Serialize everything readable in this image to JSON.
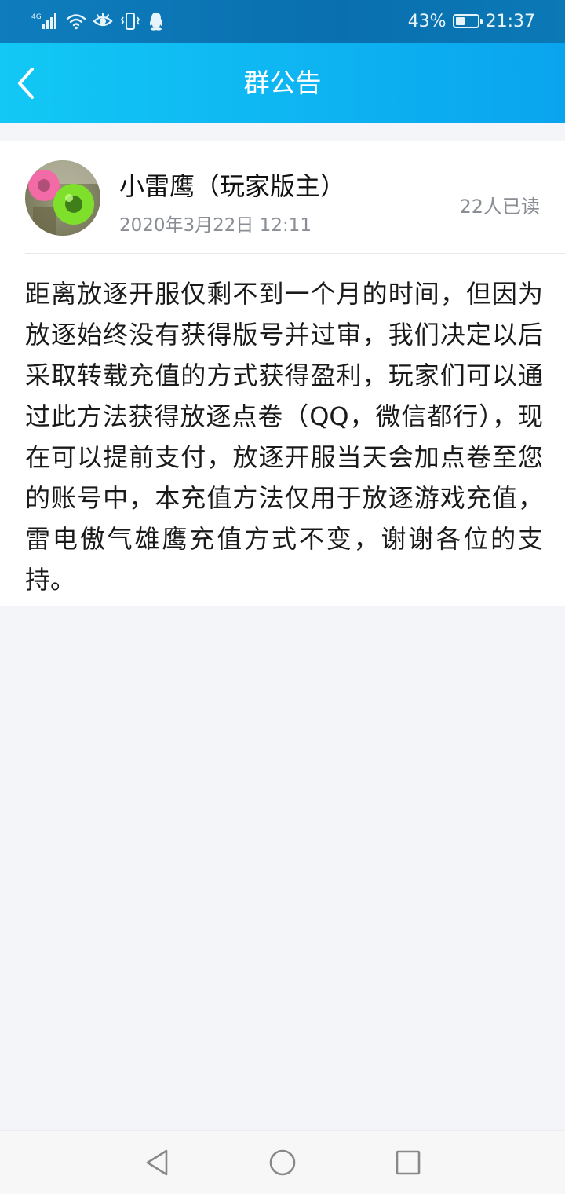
{
  "status_bar": {
    "network_label": "4G",
    "battery_percent": 43,
    "battery_text": "43%",
    "time": "21:37",
    "icons": [
      "signal-icon",
      "wifi-icon",
      "eye-icon",
      "vibrate-icon",
      "qq-penguin-icon",
      "battery-icon"
    ]
  },
  "header": {
    "title": "群公告",
    "back_icon": "back-chevron-icon",
    "colors": {
      "start": "#12c8f5",
      "end": "#0aa4ee"
    }
  },
  "post": {
    "author": "小雷鹰（玩家版主）",
    "date": "2020年3月22日 12:11",
    "read_count": "22人已读",
    "body": "距离放逐开服仅剩不到一个月的时间，但因为放逐始终没有获得版号并过审，我们决定以后采取转载充值的方式获得盈利，玩家们可以通过此方法获得放逐点卷（QQ，微信都行），现在可以提前支付，放逐开服当天会加点卷至您的账号中，本充值方法仅用于放逐游戏充值，雷电傲气雄鹰充值方式不变，谢谢各位的支持。"
  },
  "nav_bar": {
    "icons": [
      "nav-back-icon",
      "nav-home-icon",
      "nav-recents-icon"
    ]
  }
}
